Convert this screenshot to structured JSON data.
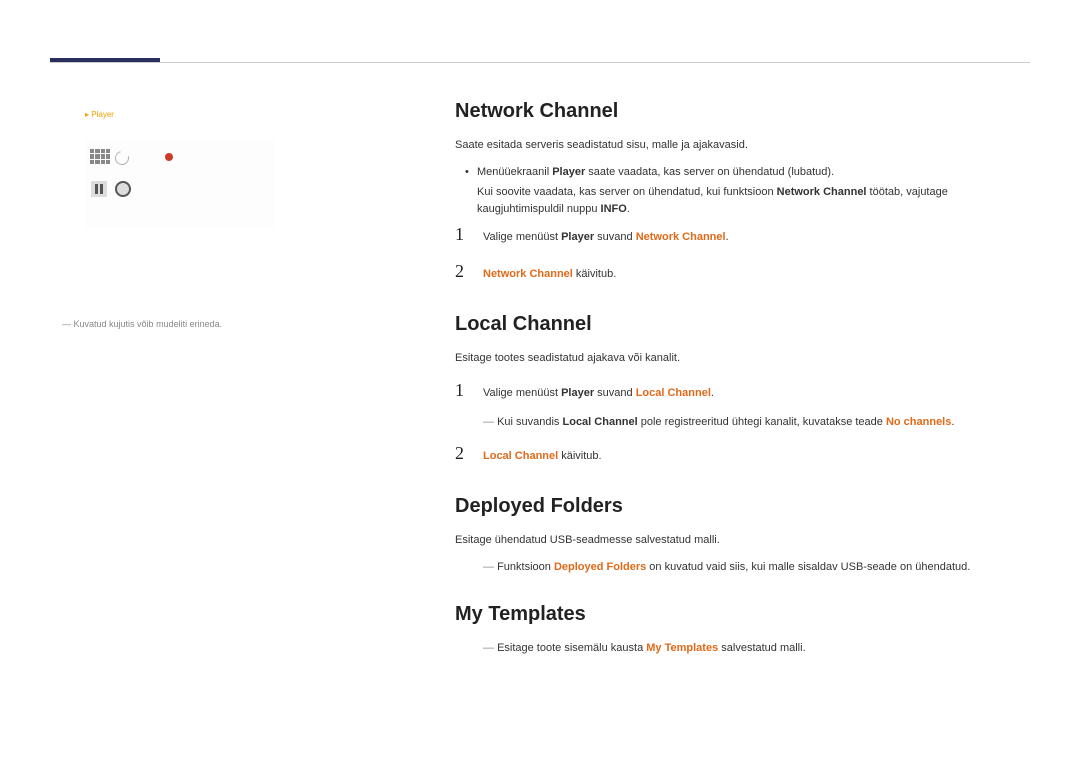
{
  "sidebar": {
    "label": "Player",
    "note": "Kuvatud kujutis võib mudeliti erineda."
  },
  "s1": {
    "title": "Network Channel",
    "intro": "Saate esitada serveris seadistatud sisu, malle ja ajakavasid.",
    "b1a": "Menüüekraanil ",
    "b1_player": "Player",
    "b1b": " saate vaadata, kas server on ühendatud (lubatud).",
    "b2a": "Kui soovite vaadata, kas server on ühendatud, kui funktsioon ",
    "b2_nc": "Network Channel",
    "b2b": " töötab, vajutage kaugjuhtimispuldil nuppu ",
    "b2_info": "INFO",
    "b2c": ".",
    "n1a": "Valige menüüst ",
    "n1_player": "Player",
    "n1b": " suvand ",
    "n1_nc": "Network Channel",
    "n1c": ".",
    "n2_nc": "Network Channel",
    "n2b": " käivitub."
  },
  "s2": {
    "title": "Local Channel",
    "intro": "Esitage tootes seadistatud ajakava või kanalit.",
    "n1a": "Valige menüüst ",
    "n1_player": "Player",
    "n1b": " suvand ",
    "n1_lc": "Local Channel",
    "n1c": ".",
    "d1a": "Kui suvandis ",
    "d1_lc": "Local Channel",
    "d1b": " pole registreeritud ühtegi kanalit, kuvatakse teade ",
    "d1_noch": "No channels",
    "d1c": ".",
    "n2_lc": "Local Channel",
    "n2b": " käivitub."
  },
  "s3": {
    "title": "Deployed Folders",
    "intro": "Esitage ühendatud USB-seadmesse salvestatud malli.",
    "d1a": "Funktsioon ",
    "d1_df": "Deployed Folders",
    "d1b": " on kuvatud vaid siis, kui malle sisaldav USB-seade on ühendatud."
  },
  "s4": {
    "title": "My Templates",
    "d1a": "Esitage toote sisemälu kausta ",
    "d1_mt": "My Templates",
    "d1b": " salvestatud malli."
  }
}
